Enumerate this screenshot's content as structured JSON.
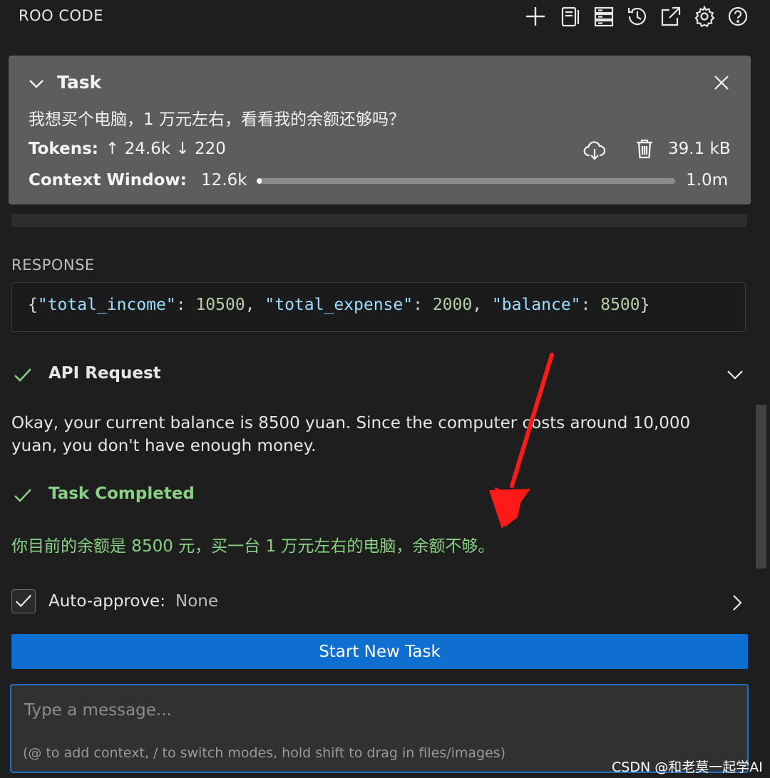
{
  "header": {
    "title": "ROO CODE",
    "icons": [
      "plus-icon",
      "prompts-icon",
      "servers-icon",
      "history-icon",
      "popout-icon",
      "gear-icon",
      "help-icon"
    ]
  },
  "task": {
    "title": "Task",
    "query": "我想买个电脑，1 万元左右，看看我的余额还够吗？",
    "tokens_label": "Tokens:",
    "tokens_in": "↑ 24.6k",
    "tokens_out": "↓ 220",
    "size": "39.1 kB",
    "context_label": "Context Window:",
    "context_used": "12.6k",
    "context_max": "1.0m",
    "context_fraction": 0.0126
  },
  "response": {
    "label": "RESPONSE",
    "json": {
      "open": "{",
      "k1": "\"total_income\"",
      "v1": "10500",
      "k2": "\"total_expense\"",
      "v2": "2000",
      "k3": "\"balance\"",
      "v3": "8500",
      "colon": ": ",
      "comma": ", ",
      "close": "}"
    }
  },
  "api_request": {
    "title": "API Request",
    "text": "Okay, your current balance is 8500 yuan. Since the computer costs around 10,000 yuan, you don't have enough money."
  },
  "completed": {
    "title": "Task Completed",
    "text": "你目前的余额是 8500 元，买一台 1 万元左右的电脑，余额不够。"
  },
  "auto_approve": {
    "label": "Auto-approve:",
    "value": "None"
  },
  "start_button": "Start New Task",
  "message": {
    "placeholder": "Type a message...",
    "hint": "(@ to add context, / to switch modes, hold shift to drag in files/images)"
  },
  "watermark": "CSDN @和老莫一起学AI",
  "colors": {
    "accent": "#0e6fd1",
    "success": "#89d185",
    "panel": "#5d5d5d",
    "arrow": "#ff1a1a"
  }
}
